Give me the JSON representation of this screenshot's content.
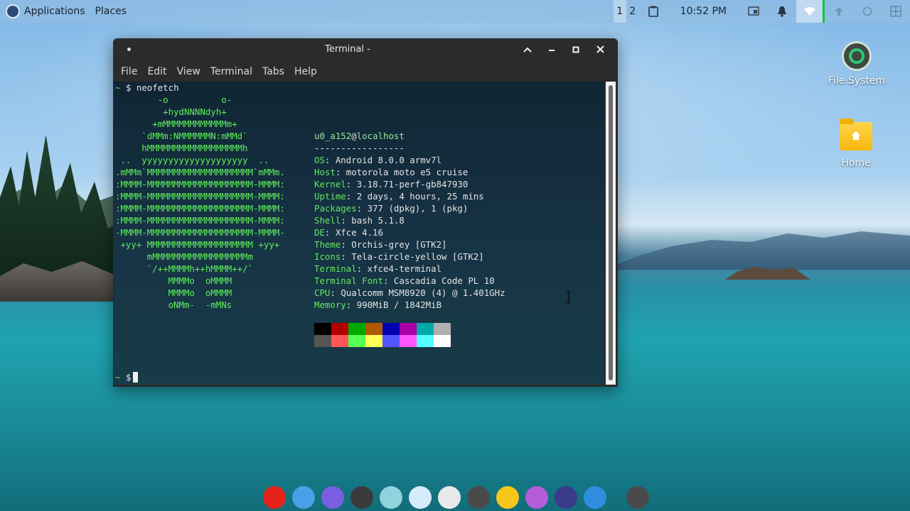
{
  "top_panel": {
    "applications_label": "Applications",
    "places_label": "Places",
    "workspaces": [
      "1",
      "2"
    ],
    "clock": "10:52 PM"
  },
  "terminal": {
    "title": "Terminal -",
    "menu": [
      "File",
      "Edit",
      "View",
      "Terminal",
      "Tabs",
      "Help"
    ],
    "prompt_symbol": "$",
    "tilde": "~",
    "command": "neofetch",
    "logo_lines": [
      "        -o          o-",
      "         +hydNNNNdyh+",
      "       +mMMMMMMMMMMMMm+",
      "     `dMMm:NMMMMMMN:mMMd`",
      "     hMMMMMMMMMMMMMMMMMMh",
      " ..  yyyyyyyyyyyyyyyyyyyy  ..",
      ".mMMm`MMMMMMMMMMMMMMMMMMMM`mMMm.",
      ":MMMM-MMMMMMMMMMMMMMMMMMMM-MMMM:",
      ":MMMM-MMMMMMMMMMMMMMMMMMMM-MMMM:",
      ":MMMM-MMMMMMMMMMMMMMMMMMMM-MMMM:",
      ":MMMM-MMMMMMMMMMMMMMMMMMMM-MMMM:",
      "-MMMM-MMMMMMMMMMMMMMMMMMMM-MMMM-",
      " +yy+ MMMMMMMMMMMMMMMMMMMM +yy+",
      "      mMMMMMMMMMMMMMMMMMMm",
      "      `/++MMMMh++hMMMM++/`",
      "          MMMMo  oMMMM",
      "          MMMMo  oMMMM",
      "          oNMm-  -mMNs"
    ],
    "user": "u0_a152",
    "at": "@",
    "host": "localhost",
    "separator": "-----------------",
    "info": [
      {
        "key": "OS",
        "value": "Android 8.0.0 armv7l"
      },
      {
        "key": "Host",
        "value": "motorola moto e5 cruise"
      },
      {
        "key": "Kernel",
        "value": "3.18.71-perf-gb847930"
      },
      {
        "key": "Uptime",
        "value": "2 days, 4 hours, 25 mins"
      },
      {
        "key": "Packages",
        "value": "377 (dpkg), 1 (pkg)"
      },
      {
        "key": "Shell",
        "value": "bash 5.1.8"
      },
      {
        "key": "DE",
        "value": "Xfce 4.16"
      },
      {
        "key": "Theme",
        "value": "Orchis-grey [GTK2]"
      },
      {
        "key": "Icons",
        "value": "Tela-circle-yellow [GTK2]"
      },
      {
        "key": "Terminal",
        "value": "xfce4-terminal"
      },
      {
        "key": "Terminal Font",
        "value": "Cascadia Code PL 10"
      },
      {
        "key": "CPU",
        "value": "Qualcomm MSM8920 (4) @ 1.401GHz"
      },
      {
        "key": "Memory",
        "value": "990MiB / 1842MiB"
      }
    ],
    "palette_row1": [
      "#000000",
      "#b30000",
      "#00a800",
      "#b05a00",
      "#0000b0",
      "#a800a8",
      "#00a8a8",
      "#b0b0b0"
    ],
    "palette_row2": [
      "#555555",
      "#ff5555",
      "#55ff55",
      "#ffff55",
      "#5555ff",
      "#ff55ff",
      "#55ffff",
      "#ffffff"
    ]
  },
  "desktop": {
    "icons": [
      {
        "label": "File System"
      },
      {
        "label": "Home"
      }
    ]
  },
  "dock": {
    "items": [
      {
        "icon": "opera-icon",
        "color": "#e3231b"
      },
      {
        "icon": "image-viewer-icon",
        "color": "#4aa0e6"
      },
      {
        "icon": "folder-icon",
        "color": "#7a5ee0"
      },
      {
        "icon": "app-a-icon",
        "color": "#3b3b3b"
      },
      {
        "icon": "media-icon",
        "color": "#8fd3df"
      },
      {
        "icon": "window-icon",
        "color": "#d7ecfa"
      },
      {
        "icon": "record-icon",
        "color": "#e8e8e8"
      },
      {
        "icon": "terminal-icon",
        "color": "#4a4a4a"
      },
      {
        "icon": "emoji-icon",
        "color": "#f6c61a"
      },
      {
        "icon": "chat-icon",
        "color": "#b35dd8"
      },
      {
        "icon": "monitor-icon",
        "color": "#3a3a8a"
      },
      {
        "icon": "toggle-icon",
        "color": "#2f8ee0"
      },
      {
        "icon": "terminal-2-icon",
        "color": "#4a4a4a"
      }
    ]
  }
}
